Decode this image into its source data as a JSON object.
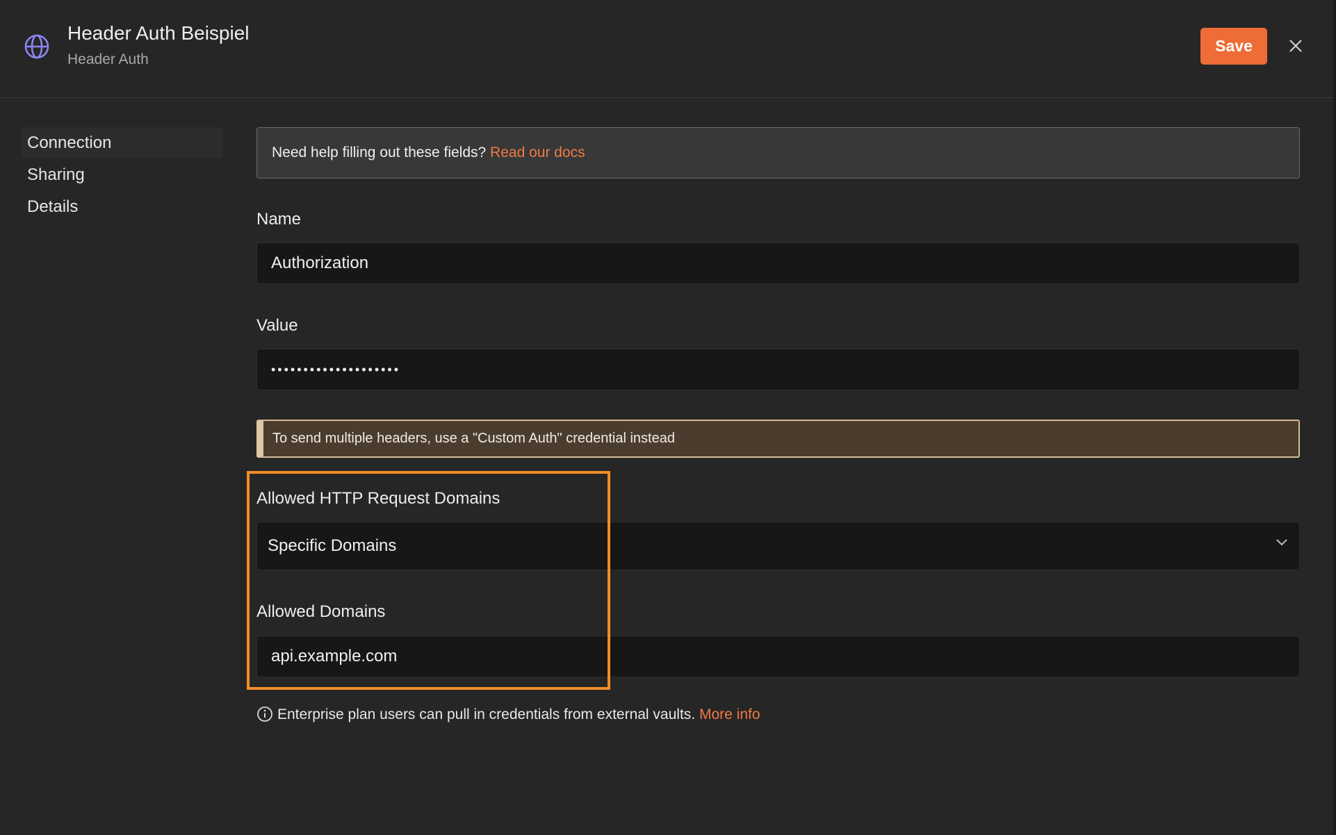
{
  "header": {
    "title": "Header Auth Beispiel",
    "subtitle": "Header Auth",
    "save_label": "Save",
    "icon": "globe-icon"
  },
  "sidebar": {
    "items": [
      {
        "label": "Connection",
        "active": true
      },
      {
        "label": "Sharing",
        "active": false
      },
      {
        "label": "Details",
        "active": false
      }
    ]
  },
  "help": {
    "text": "Need help filling out these fields?",
    "link": "Read our docs"
  },
  "fields": {
    "name": {
      "label": "Name",
      "value": "Authorization"
    },
    "value": {
      "label": "Value",
      "value": "••••••••••••••••••••"
    }
  },
  "notice": {
    "text": "To send multiple headers, use a \"Custom Auth\" credential instead"
  },
  "domains": {
    "label": "Allowed HTTP Request Domains",
    "selected": "Specific Domains",
    "allowed_label": "Allowed Domains",
    "allowed_value": "api.example.com"
  },
  "footer_info": {
    "text": "Enterprise plan users can pull in credentials from external vaults.",
    "link": "More info"
  },
  "colors": {
    "accent": "#ee6c36",
    "link": "#ee7a45",
    "highlight": "#f28c28",
    "notice_bg": "#4b3d2e"
  }
}
